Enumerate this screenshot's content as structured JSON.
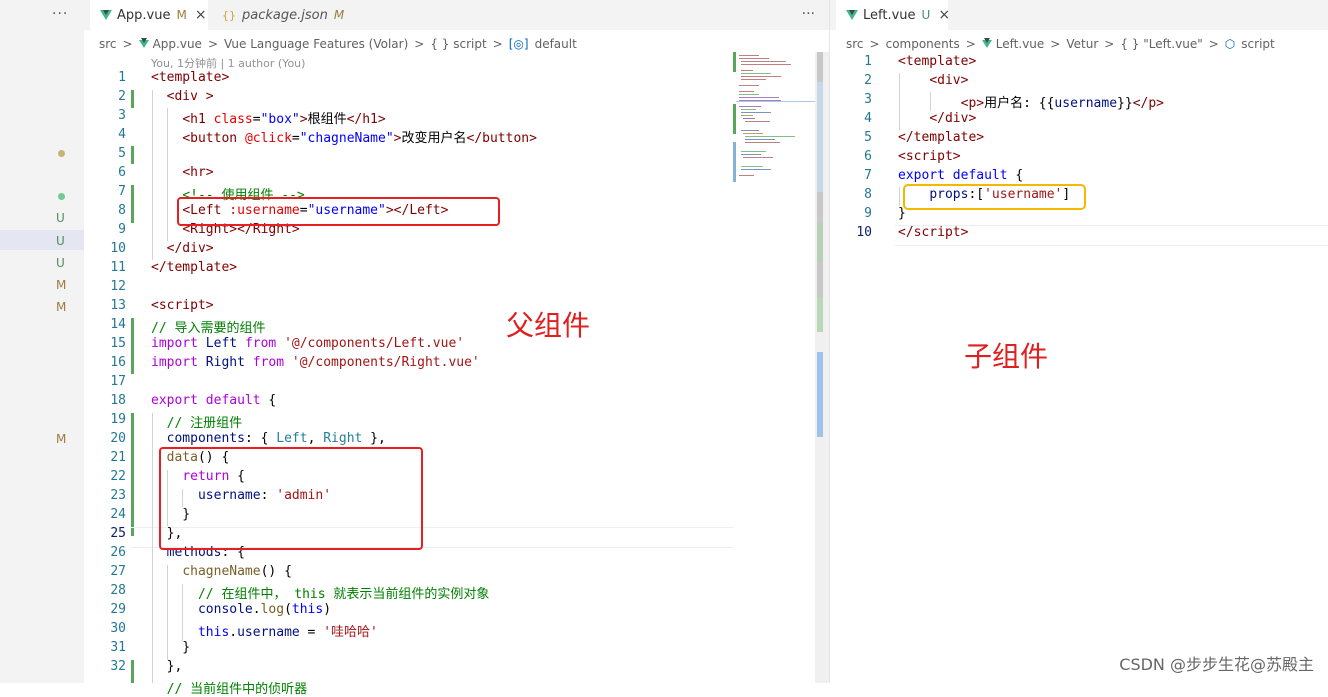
{
  "explorer": {
    "more_icon": "ellipsis-icon",
    "badges": [
      "U",
      "U",
      "U",
      "M",
      "M",
      "M"
    ]
  },
  "left_editor": {
    "tabs": [
      {
        "label": "App.vue",
        "status": "M",
        "close": "×",
        "icon": "vue-icon"
      },
      {
        "label": "package.json",
        "status": "M",
        "icon": "braces-icon"
      }
    ],
    "more": "···",
    "breadcrumb": [
      "src",
      ">",
      "App.vue",
      ">",
      "Vue Language Features (Volar)",
      ">",
      "{ } script",
      ">",
      "default"
    ],
    "blame": "You, 1分钟前 | 1 author (You)",
    "line_numbers": [
      "1",
      "2",
      "3",
      "4",
      "5",
      "6",
      "7",
      "8",
      "9",
      "10",
      "11",
      "12",
      "13",
      "14",
      "15",
      "16",
      "17",
      "18",
      "19",
      "20",
      "21",
      "22",
      "23",
      "24",
      "25",
      "26",
      "27",
      "28",
      "29",
      "30",
      "31",
      "32"
    ],
    "annotation_label": "父组件"
  },
  "right_editor": {
    "tabs": [
      {
        "label": "Left.vue",
        "status": "U",
        "close": "×",
        "icon": "vue-icon"
      }
    ],
    "breadcrumb": [
      "src",
      ">",
      "components",
      ">",
      "Left.vue",
      ">",
      "Vetur",
      ">",
      "{ } \"Left.vue\"",
      ">",
      "script"
    ],
    "line_numbers": [
      "1",
      "2",
      "3",
      "4",
      "5",
      "6",
      "7",
      "8",
      "9",
      "10"
    ],
    "annotation_label": "子组件"
  },
  "watermark": "CSDN @步步生花@苏殿主",
  "colors": {
    "accent_red": "#e62020",
    "accent_orange": "#f5b800",
    "git_added": "#58a55c",
    "git_modified": "#84b0d9"
  }
}
